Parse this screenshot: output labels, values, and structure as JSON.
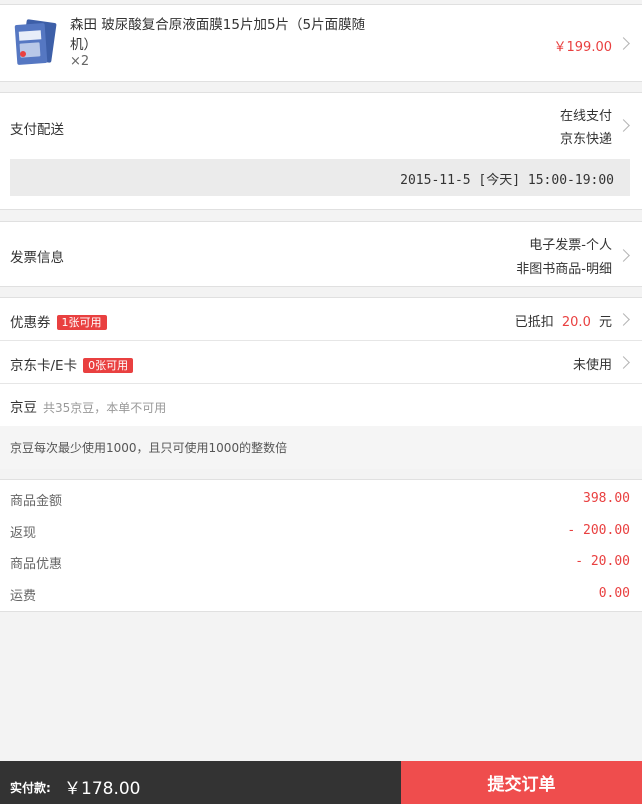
{
  "product": {
    "name": "森田 玻尿酸复合原液面膜15片加5片（5片面膜随机）",
    "quantity": "×2",
    "price": "￥199.00"
  },
  "payment": {
    "label": "支付配送",
    "pay_method": "在线支付",
    "shipping": "京东快递",
    "delivery_time": "2015-11-5 [今天] 15:00-19:00"
  },
  "invoice": {
    "label": "发票信息",
    "type": "电子发票-个人",
    "detail": "非图书商品-明细"
  },
  "coupon": {
    "label": "优惠券",
    "badge": "1张可用",
    "prefix": "已抵扣",
    "amount": "20.0",
    "unit": "元"
  },
  "ecard": {
    "label": "京东卡/E卡",
    "badge": "0张可用",
    "status": "未使用"
  },
  "jingdou": {
    "label": "京豆",
    "info": "共35京豆，本单不可用",
    "note": "京豆每次最少使用1000，且只可使用1000的整数倍"
  },
  "summary": [
    {
      "label": "商品金额",
      "value": "398.00"
    },
    {
      "label": "返现",
      "value": "- 200.00"
    },
    {
      "label": "商品优惠",
      "value": "- 20.00"
    },
    {
      "label": "运费",
      "value": "0.00"
    }
  ],
  "footer": {
    "pay_label": "实付款:",
    "pay_amount": "￥178.00",
    "submit_label": "提交订单"
  },
  "colors": {
    "accent": "#e94040",
    "footer_bg": "#333333",
    "submit_bg": "#ef4d4d"
  }
}
